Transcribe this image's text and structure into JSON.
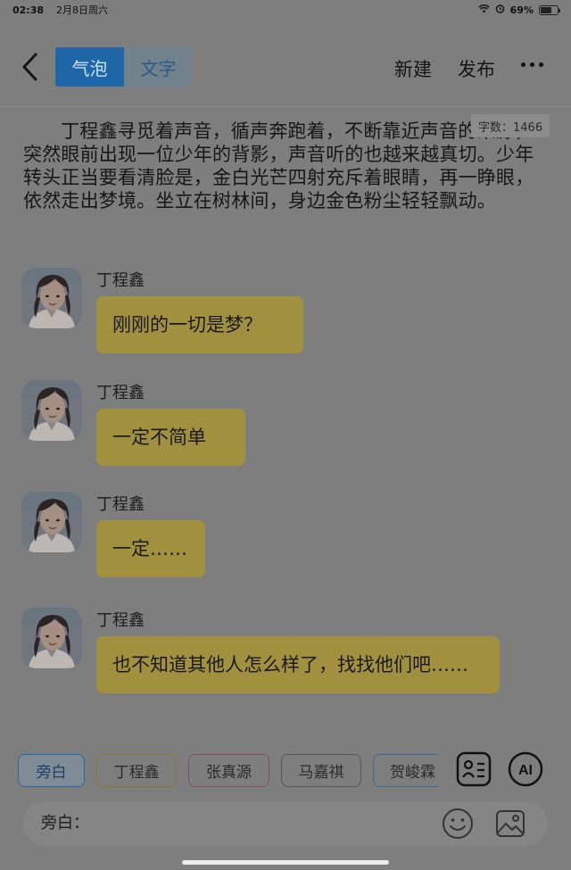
{
  "status_bar": {
    "time": "02:38",
    "date": "2月8日周六",
    "battery_text": "69%",
    "battery_level": 0.69
  },
  "header": {
    "tabs": [
      {
        "label": "气泡",
        "active": true
      },
      {
        "label": "文字",
        "active": false
      }
    ],
    "new_label": "新建",
    "publish_label": "发布",
    "more_icon": "more-icon"
  },
  "word_count": "字数：1466",
  "narration": "丁程鑫寻觅着声音，循声奔跑着，不断靠近声音的来源，突然眼前出现一位少年的背影，声音听的也越来越真切。少年转头正当要看清脸是，金白光芒四射充斥着眼睛，再一睁眼，依然走出梦境。坐立在树林间，身边金色粉尘轻轻飘动。",
  "messages": [
    {
      "sender": "丁程鑫",
      "text": "刚刚的一切是梦？"
    },
    {
      "sender": "丁程鑫",
      "text": "一定不简单"
    },
    {
      "sender": "丁程鑫",
      "text": "一定……"
    },
    {
      "sender": "丁程鑫",
      "text": "也不知道其他人怎么样了，找找他们吧……"
    }
  ],
  "characters": [
    "旁白",
    "丁程鑫",
    "张真源",
    "马嘉祺",
    "贺峻霖"
  ],
  "input": {
    "label": "旁白："
  },
  "colors": {
    "accent": "#1e66a8",
    "bubble": "#a1913f",
    "background": "#7e7e7e"
  },
  "icons": {
    "back": "chevron-left-icon",
    "character_manager": "character-card-icon",
    "ai": "ai-icon",
    "emoji": "emoji-icon",
    "image": "image-icon"
  }
}
